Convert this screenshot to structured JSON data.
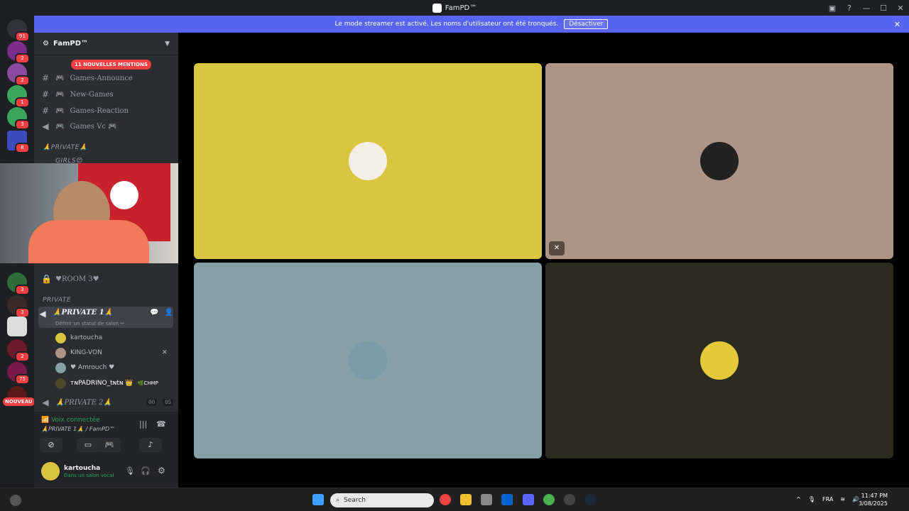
{
  "window": {
    "title": "FamPD™",
    "controls": [
      "monitor-icon",
      "help-icon",
      "minimize-icon",
      "maximize-icon",
      "close-icon"
    ]
  },
  "servers": {
    "badges": [
      "91",
      "2",
      "2",
      "1",
      "3",
      "8",
      "3",
      "3",
      "2",
      "75"
    ],
    "new_label": "NOUVEAU"
  },
  "banner": {
    "text": "Le mode streamer est activé. Les noms d'utilisateur ont été tronqués.",
    "button": "Désactiver"
  },
  "sidebar": {
    "server_name": "FamPD™",
    "mentions_pill": "11 NOUVELLES MENTIONS",
    "channels": [
      {
        "name": "Games-Announce",
        "prefix": "🎮"
      },
      {
        "name": "New-Games",
        "prefix": "🎮"
      },
      {
        "name": "Games-Reaction",
        "prefix": "🎮"
      },
      {
        "name": "Games Vc 🎮",
        "prefix": "🎮"
      }
    ],
    "category_private_top": "🙏PRIVATE🙏",
    "girls_channel": "GIRLS😊",
    "room3": "♥ROOM 3♥",
    "category_private": "PRIVATE",
    "private1": {
      "name": "🙏PRIVATE 1🙏",
      "status": "Définir un statut de salon ✏"
    },
    "members": [
      {
        "name": "kartoucha",
        "extra": ""
      },
      {
        "name": "KING-VON",
        "extra": ""
      },
      {
        "name": "♥ Amrouch ♥",
        "extra": ""
      },
      {
        "name": "ᴛɴPADRINO_tɴtɴ 👑",
        "extra": "🌿CHMP"
      }
    ],
    "private2": {
      "name": "🙏PRIVATE 2🙏",
      "counts": [
        "00",
        "05"
      ]
    }
  },
  "voice": {
    "status": "Voix connectée",
    "channel": "🙏PRIVATE 1🙏 / FamPD™"
  },
  "user": {
    "name": "kartoucha",
    "status": "Dans un salon vocal"
  },
  "tiles": [
    {
      "color": "#d9c53f",
      "avatar": "avatar-beard-man"
    },
    {
      "color": "#ae9486",
      "avatar": "avatar-mj",
      "muted": true
    },
    {
      "color": "#85a0a7",
      "avatar": "avatar-standing-man"
    },
    {
      "color": "#2b2b1f",
      "avatar": "avatar-cartoon"
    }
  ],
  "taskbar": {
    "search_placeholder": "Search",
    "lang": "FRA",
    "time": "11:47 PM",
    "date": "3/08/2025"
  }
}
